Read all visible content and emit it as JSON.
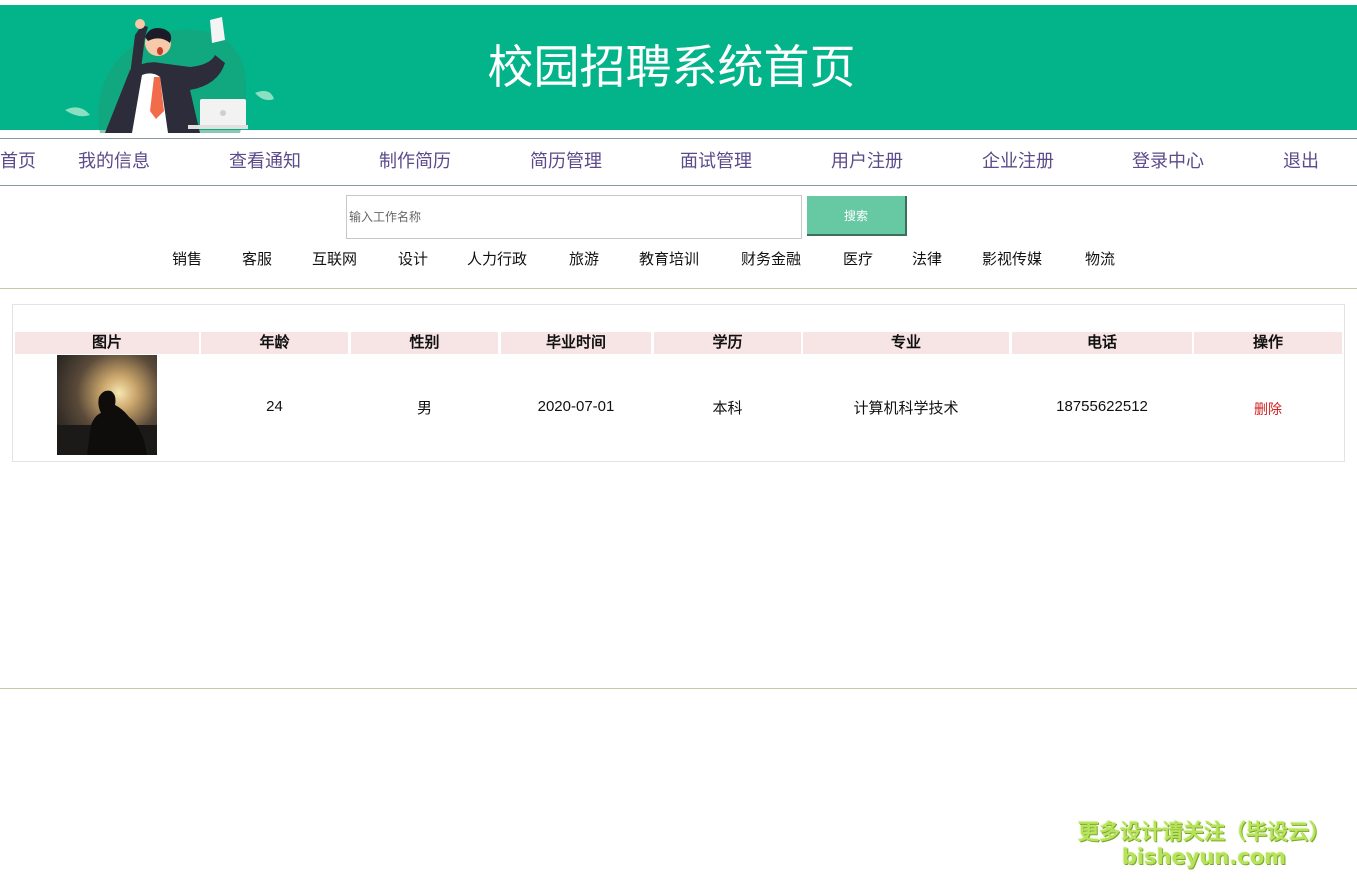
{
  "banner": {
    "title": "校园招聘系统首页",
    "bg_color": "#03b38a"
  },
  "nav": {
    "items": [
      {
        "label": "首页"
      },
      {
        "label": "我的信息"
      },
      {
        "label": "查看通知"
      },
      {
        "label": "制作简历"
      },
      {
        "label": "简历管理"
      },
      {
        "label": "面试管理"
      },
      {
        "label": "用户注册"
      },
      {
        "label": "企业注册"
      },
      {
        "label": "登录中心"
      },
      {
        "label": "退出"
      }
    ],
    "text_color": "#5b4b8a"
  },
  "search": {
    "placeholder": "输入工作名称",
    "value": "",
    "button_label": "搜索",
    "button_color": "#66c9a3"
  },
  "categories": [
    "销售",
    "客服",
    "互联网",
    "设计",
    "人力行政",
    "旅游",
    "教育培训",
    "财务金融",
    "医疗",
    "法律",
    "影视传媒",
    "物流"
  ],
  "table": {
    "headers": [
      "图片",
      "年龄",
      "性别",
      "毕业时间",
      "学历",
      "专业",
      "电话",
      "操作"
    ],
    "header_bg": "#f7e4e4",
    "rows": [
      {
        "photo": "photo",
        "age": "24",
        "gender": "男",
        "graduation": "2020-07-01",
        "education": "本科",
        "major": "计算机科学技术",
        "phone": "18755622512",
        "action": "删除"
      }
    ]
  },
  "watermark": {
    "line1": "更多设计请关注（毕设云）",
    "line2": "bisheyun.com"
  }
}
